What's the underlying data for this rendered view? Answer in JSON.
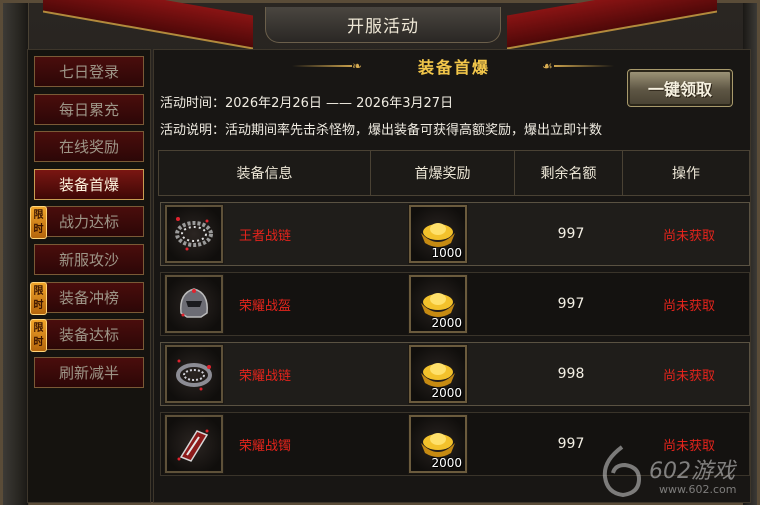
{
  "window": {
    "title": "开服活动"
  },
  "sidebar": {
    "items": [
      {
        "label": "七日登录",
        "limited": false,
        "active": false
      },
      {
        "label": "每日累充",
        "limited": false,
        "active": false
      },
      {
        "label": "在线奖励",
        "limited": false,
        "active": false
      },
      {
        "label": "装备首爆",
        "limited": false,
        "active": true
      },
      {
        "label": "战力达标",
        "limited": true,
        "active": false
      },
      {
        "label": "新服攻沙",
        "limited": false,
        "active": false
      },
      {
        "label": "装备冲榜",
        "limited": true,
        "active": false
      },
      {
        "label": "装备达标",
        "limited": true,
        "active": false
      },
      {
        "label": "刷新减半",
        "limited": false,
        "active": false
      }
    ],
    "limited_badge": {
      "top": "限",
      "bottom": "时"
    }
  },
  "main": {
    "section_title": "装备首爆",
    "time_label": "活动时间：",
    "time_value": "2026年2月26日 —— 2026年3月27日",
    "desc_label": "活动说明：",
    "desc_value": "活动期间率先击杀怪物，爆出装备可获得高额奖励，爆出立即计数",
    "claim_all_label": "一键领取",
    "table": {
      "headers": [
        "装备信息",
        "首爆奖励",
        "剩余名额",
        "操作"
      ],
      "rows": [
        {
          "name": "王者战链",
          "icon": "necklace-icon",
          "reward": "1000",
          "remaining": "997",
          "status": "尚未获取"
        },
        {
          "name": "荣耀战盔",
          "icon": "helmet-icon",
          "reward": "2000",
          "remaining": "997",
          "status": "尚未获取"
        },
        {
          "name": "荣耀战链",
          "icon": "necklace-icon",
          "reward": "2000",
          "remaining": "998",
          "status": "尚未获取"
        },
        {
          "name": "荣耀战镯",
          "icon": "bracelet-icon",
          "reward": "2000",
          "remaining": "997",
          "status": "尚未获取"
        }
      ]
    }
  },
  "watermark": {
    "text": "602游戏",
    "sub": "www.602.com"
  }
}
